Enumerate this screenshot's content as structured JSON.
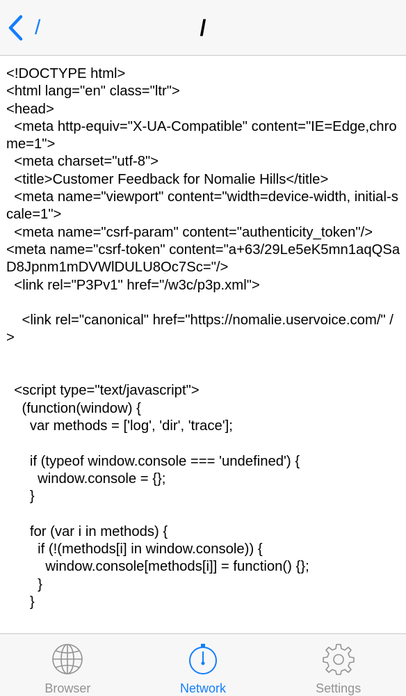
{
  "navbar": {
    "back_label": "/",
    "title": "/"
  },
  "source_text": "<!DOCTYPE html>\n<html lang=\"en\" class=\"ltr\">\n<head>\n  <meta http-equiv=\"X-UA-Compatible\" content=\"IE=Edge,chrome=1\">\n  <meta charset=\"utf-8\">\n  <title>Customer Feedback for Nomalie Hills</title>\n  <meta name=\"viewport\" content=\"width=device-width, initial-scale=1\">\n  <meta name=\"csrf-param\" content=\"authenticity_token\"/>\n<meta name=\"csrf-token\" content=\"a+63/29Le5eK5mn1aqQSaD8Jpnm1mDVWlDULU8Oc7Sc=\"/>\n  <link rel=\"P3Pv1\" href=\"/w3c/p3p.xml\">\n\n    <link rel=\"canonical\" href=\"https://nomalie.uservoice.com/\" />\n\n\n  <script type=\"text/javascript\">\n    (function(window) {\n      var methods = ['log', 'dir', 'trace'];\n\n      if (typeof window.console === 'undefined') {\n        window.console = {};\n      }\n\n      for (var i in methods) {\n        if (!(methods[i] in window.console)) {\n          window.console[methods[i]] = function() {};\n        }\n      }",
  "tabs": [
    {
      "label": "Browser",
      "icon": "globe-icon",
      "active": false
    },
    {
      "label": "Network",
      "icon": "stopwatch-icon",
      "active": true
    },
    {
      "label": "Settings",
      "icon": "gear-icon",
      "active": false
    }
  ],
  "colors": {
    "accent": "#157efb",
    "inactive": "#929292",
    "bar_background": "#f7f7f7"
  }
}
